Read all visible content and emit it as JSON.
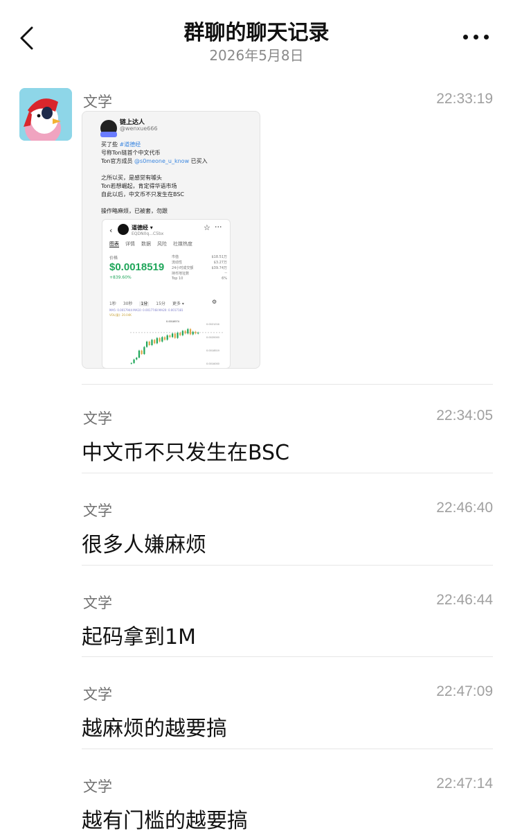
{
  "header": {
    "title": "群聊的聊天记录",
    "date": "2026年5月8日"
  },
  "colors": {
    "background": "#ffffff",
    "sender": "#6f6f6f",
    "time": "#a0a0a0",
    "divider": "#e6e6e6",
    "price_green": "#1fa65a",
    "avatar_bg": "#8ed6e8"
  },
  "icons": {
    "back": "chevron-left-icon",
    "more": "more-dots-icon"
  },
  "messages": [
    {
      "sender": "文学",
      "time": "22:33:19",
      "type": "image"
    },
    {
      "sender": "文学",
      "time": "22:34:05",
      "text": "中文币不只发生在BSC"
    },
    {
      "sender": "文学",
      "time": "22:46:40",
      "text": "很多人嫌麻烦"
    },
    {
      "sender": "文学",
      "time": "22:46:44",
      "text": "起码拿到1M"
    },
    {
      "sender": "文学",
      "time": "22:47:09",
      "text": "越麻烦的越要搞"
    },
    {
      "sender": "文学",
      "time": "22:47:14",
      "text": "越有门槛的越要搞"
    }
  ],
  "embedded_post": {
    "name": "链上达人",
    "handle": "@wenxue666",
    "lines": [
      {
        "pre": "买了些 ",
        "hl": "#道德经",
        "post": ""
      },
      {
        "pre": "号称Ton链首个中文代币",
        "hl": "",
        "post": ""
      },
      {
        "pre": "Ton官方成员 ",
        "hl": "@s0meone_u_know",
        "post": " 已买入"
      },
      {
        "pre": "",
        "hl": "",
        "post": ""
      },
      {
        "pre": "之所以买，是感觉有噱头",
        "hl": "",
        "post": ""
      },
      {
        "pre": "Ton若想崛起，肯定得华语市场",
        "hl": "",
        "post": ""
      },
      {
        "pre": "自此以后，中文币不只发生在BSC",
        "hl": "",
        "post": ""
      },
      {
        "pre": "",
        "hl": "",
        "post": ""
      },
      {
        "pre": "操作略麻烦，已被套，勿跟",
        "hl": "",
        "post": ""
      }
    ],
    "token_card": {
      "name": "道德经 ▾",
      "address": "EQDN0q...C5bx",
      "tabs": [
        "图表",
        "详情",
        "数据",
        "风险",
        "社媒热度"
      ],
      "price_label": "价格",
      "price": "$0.0018519",
      "change": "+839.60%",
      "stats": [
        {
          "label": "市值",
          "value": "$18.51万"
        },
        {
          "label": "流动性",
          "value": "$3.27万"
        },
        {
          "label": "24小时成交额",
          "value": "$39.74万"
        },
        {
          "label": "持币地址数",
          "value": "--"
        },
        {
          "label": "Top 10",
          "value": "6%"
        }
      ],
      "intervals": [
        "1秒",
        "30秒",
        "1分",
        "15分",
        "更多 ▾"
      ],
      "ma_line": "MA5: 0.0017944  MA10: 0.0017748  MA20: 0.0017181",
      "vol_line": "VOL(量): 20.04K",
      "y_ticks": [
        "0.0021216",
        "0.0020000",
        "0.0018519",
        "0.0016000"
      ],
      "high_label": "0.0018974",
      "chart_data": {
        "type": "candlestick",
        "closes": [
          0.00152,
          0.00156,
          0.00158,
          0.00166,
          0.00162,
          0.0017,
          0.00176,
          0.00172,
          0.00178,
          0.00174,
          0.0018,
          0.00176,
          0.00181,
          0.00178,
          0.00183,
          0.00181,
          0.00185,
          0.0018,
          0.00186,
          0.00183,
          0.00188,
          0.00185,
          0.0019,
          0.00184,
          0.00187,
          0.00185,
          0.00186
        ],
        "ylim": [
          0.00148,
          0.00196
        ]
      }
    }
  }
}
